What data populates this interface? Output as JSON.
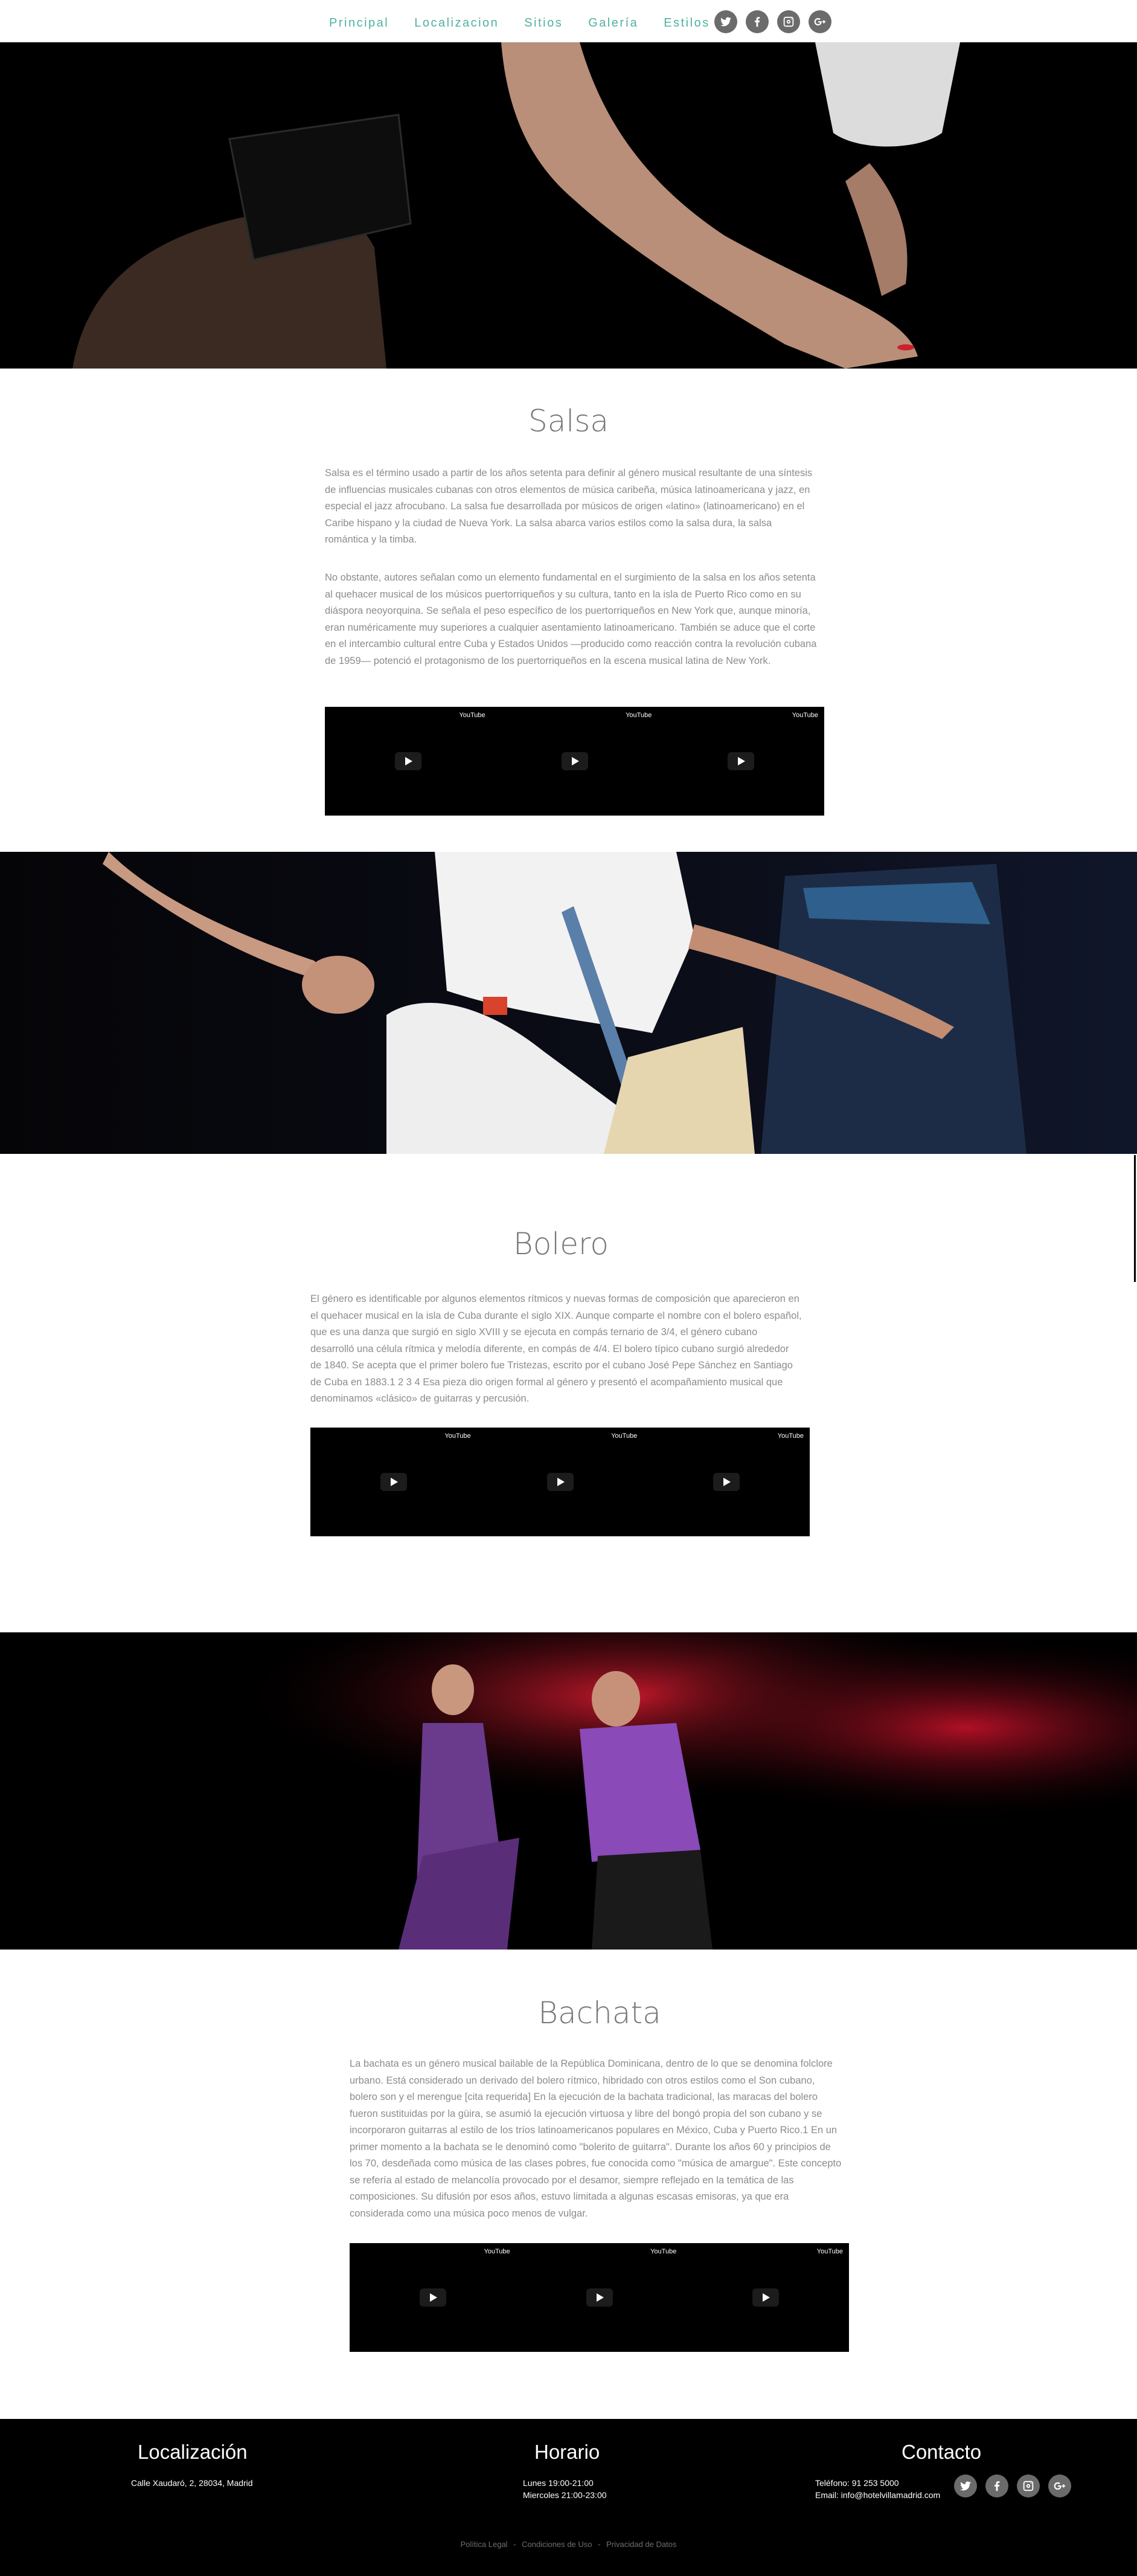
{
  "nav": {
    "links": [
      "Principal",
      "Localizacion",
      "Sitios",
      "Galería",
      "Estilos"
    ],
    "social_icons": [
      "twitter-icon",
      "facebook-icon",
      "instagram-icon",
      "google-plus-icon"
    ]
  },
  "sections": [
    {
      "title": "Salsa",
      "paragraphs": [
        "Salsa es el término usado a partir de los años setenta para definir al género musical resultante de una síntesis de influencias musicales cubanas con otros elementos de música caribeña, música latinoamericana y jazz, en especial el jazz afrocubano. La salsa fue desarrollada por músicos de origen «latino» (latinoamericano) en el Caribe hispano y la ciudad de Nueva York. La salsa abarca varios estilos como la salsa dura, la salsa romántica y la timba.",
        "No obstante, autores señalan como un elemento fundamental en el surgimiento de la salsa en los años setenta al quehacer musical de los músicos puertorriqueños y su cultura, tanto en la isla de Puerto Rico como en su diáspora neoyorquina. Se señala el peso específico de los puertorriqueños en New York que, aunque minoría, eran numéricamente muy superiores a cualquier asentamiento latinoamericano. También se aduce que el corte en el intercambio cultural entre Cuba y Estados Unidos —producido como reacción contra la revolución cubana de 1959— potenció el protagonismo de los puertorriqueños en la escena musical latina de New York."
      ],
      "video_label": "YouTube"
    },
    {
      "title": "Bolero",
      "paragraphs": [
        "El género es identificable por algunos elementos rítmicos y nuevas formas de composición que aparecieron en el quehacer musical en la isla de Cuba durante el siglo XIX. Aunque comparte el nombre con el bolero español, que es una danza que surgió en siglo XVIII y se ejecuta en compás ternario de 3/4, el género cubano desarrolló una célula rítmica y melodía diferente, en compás de 4/4. El bolero típico cubano surgió alrededor de 1840. Se acepta que el primer bolero fue Tristezas, escrito por el cubano José Pepe Sánchez en Santiago de Cuba en 1883.1 2 3 4 Esa pieza dio origen formal al género y presentó el acompañamiento musical que denominamos «clásico» de guitarras y percusión."
      ],
      "video_label": "YouTube"
    },
    {
      "title": "Bachata",
      "paragraphs": [
        "La bachata es un género musical bailable de la República Dominicana, dentro de lo que se denomina folclore urbano. Está considerado un derivado del bolero rítmico, hibridado con otros estilos como el Son cubano, bolero son y el merengue [cita requerida] En la ejecución de la bachata tradicional, las maracas del bolero fueron sustituidas por la güira, se asumió la ejecución virtuosa y libre del bongó propia del son cubano y se incorporaron guitarras al estilo de los tríos latinoamericanos populares en México, Cuba y Puerto Rico.1 En un primer momento a la bachata se le denominó como \"bolerito de guitarra\". Durante los años 60 y principios de los 70, desdeñada como música de las clases pobres, fue conocida como \"música de amargue\". Este concepto se refería al estado de melancolía provocado por el desamor, siempre reflejado en la temática de las composiciones. Su difusión por esos años, estuvo limitada a algunas escasas emisoras, ya que era considerada como una música poco menos de vulgar."
      ],
      "video_label": "YouTube"
    }
  ],
  "footer": {
    "location": {
      "title": "Localización",
      "address": "Calle Xaudaró, 2, 28034, Madrid"
    },
    "hours": {
      "title": "Horario",
      "line1": "Lunes 19:00-21:00",
      "line2": "Miercoles 21:00-23:00"
    },
    "contact": {
      "title": "Contacto",
      "phone": "Teléfono: 91 253 5000",
      "email": "Email: info@hotelvillamadrid.com"
    },
    "legal_links": [
      "Política Legal",
      "Condiciones de Uso",
      "Privacidad de Datos"
    ],
    "separator": "-"
  }
}
